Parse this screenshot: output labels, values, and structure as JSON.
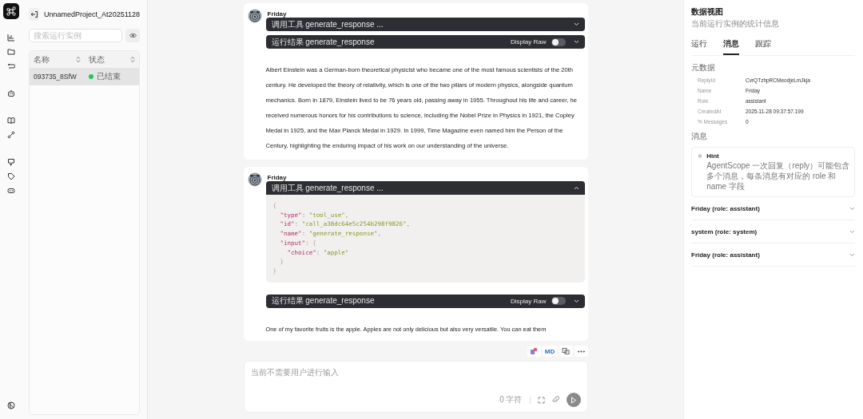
{
  "project": {
    "title": "UnnamedProject_At20251128"
  },
  "search": {
    "placeholder": "搜索运行实例"
  },
  "runs_table": {
    "columns": [
      "名称",
      "状态"
    ],
    "rows": [
      {
        "name": "093735_8SfW",
        "status": "已结束",
        "color": "#22c55e",
        "selected": true
      }
    ]
  },
  "messages": [
    {
      "sender": "Friday",
      "blocks": [
        {
          "kind": "tool_call",
          "label": "调用工具 generate_response ...",
          "expanded": false
        },
        {
          "kind": "tool_result",
          "label": "运行结果 generate_response",
          "toggle_label": "Display Raw",
          "display_raw": false,
          "expanded": false
        },
        {
          "kind": "text",
          "text": "Albert Einstein was a German-born theoretical physicist who became one of the most famous scientists of the 20th century. He developed the theory of relativity, which is one of the two pillars of modern physics, alongside quantum mechanics. Born in 1879, Einstein lived to be 76 years old, passing away in 1955. Throughout his life and career, he received numerous honors for his contributions to science, including the Nobel Prize in Physics in 1921, the Copley Medal in 1925, and the Max Planck Medal in 1929. In 1999, Time Magazine even named him the Person of the Century, highlighting the enduring impact of his work on our understanding of the universe."
        }
      ]
    },
    {
      "sender": "Friday",
      "blocks": [
        {
          "kind": "tool_call",
          "label": "调用工具 generate_response ...",
          "expanded": true,
          "code": "{\n  \"type\": \"tool_use\",\n  \"id\": \"call_a38dc64e5c254b298f9826\",\n  \"name\": \"generate_response\",\n  \"input\": {\n    \"choice\": \"apple\"\n  }\n}"
        },
        {
          "kind": "tool_result",
          "label": "运行结果 generate_response",
          "toggle_label": "Display Raw",
          "display_raw": false,
          "expanded": false
        },
        {
          "kind": "text",
          "text": "One of my favorite fruits is the apple. Apples are not only delicious but also very versatile. You can eat them"
        }
      ]
    }
  ],
  "message_actions": {
    "md_label": "MD"
  },
  "input": {
    "placeholder": "当前不需要用户进行输入",
    "char_count": "0 字符"
  },
  "data_view": {
    "title": "数据视图",
    "subtitle": "当前运行实例的统计信息",
    "tabs": [
      {
        "label": "运行",
        "selected": false
      },
      {
        "label": "消息",
        "selected": true
      },
      {
        "label": "跟踪",
        "selected": false
      }
    ],
    "metadata_title": "元数据",
    "metadata": [
      {
        "key": "ReplyId",
        "value": "CvrQTzhpRCMeodjeLmJkja"
      },
      {
        "key": "Name",
        "value": "Friday"
      },
      {
        "key": "Role",
        "value": "assistant"
      },
      {
        "key": "CreatedAt",
        "value": "2025-11-28 09:37:57.199"
      },
      {
        "key": "% Messages",
        "value": "0"
      }
    ],
    "messages_title": "消息",
    "hint": {
      "title": "Hint",
      "text": "AgentScope 一次回复（reply）可能包含多个消息，每条消息有对应的 role 和 name 字段"
    },
    "message_items": [
      {
        "label": "Friday (role: assistant)",
        "expanded": false
      },
      {
        "label": "system (role: system)",
        "expanded": false
      },
      {
        "label": "Friday (role: assistant)",
        "expanded": false
      }
    ]
  }
}
